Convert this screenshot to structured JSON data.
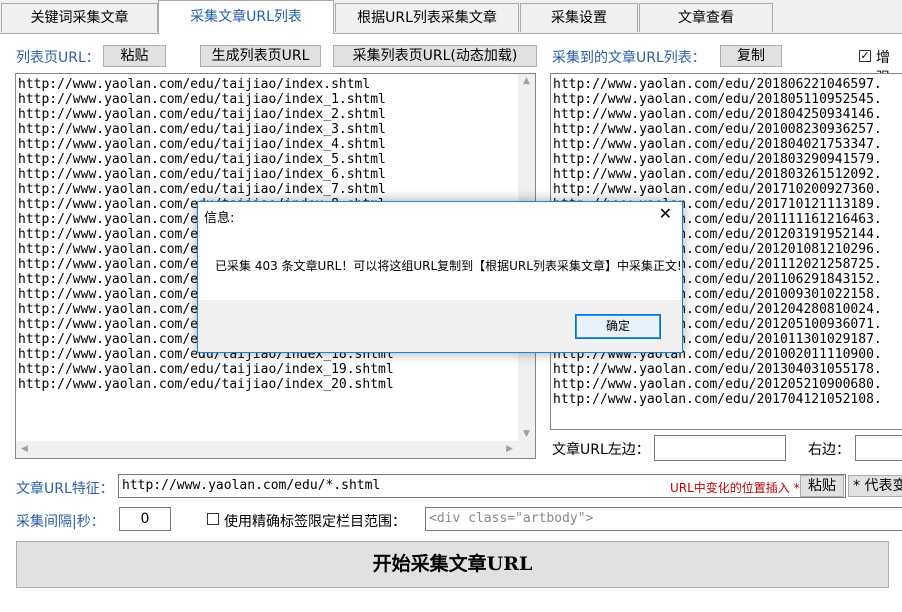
{
  "tabs": [
    {
      "label": "关键词采集文章"
    },
    {
      "label": "采集文章URL列表"
    },
    {
      "label": "根据URL列表采集文章"
    },
    {
      "label": "采集设置"
    },
    {
      "label": "文章查看"
    }
  ],
  "left_panel": {
    "label": "列表页URL：",
    "paste_button": "粘贴",
    "generate_button": "生成列表页URL",
    "collect_button": "采集列表页URL(动态加载)",
    "urls": [
      "http://www.yaolan.com/edu/taijiao/index.shtml",
      "http://www.yaolan.com/edu/taijiao/index_1.shtml",
      "http://www.yaolan.com/edu/taijiao/index_2.shtml",
      "http://www.yaolan.com/edu/taijiao/index_3.shtml",
      "http://www.yaolan.com/edu/taijiao/index_4.shtml",
      "http://www.yaolan.com/edu/taijiao/index_5.shtml",
      "http://www.yaolan.com/edu/taijiao/index_6.shtml",
      "http://www.yaolan.com/edu/taijiao/index_7.shtml",
      "http://www.yaolan.com/edu/taijiao/index_8.shtml",
      "http://www.yaolan.com/edu/taijiao/index_9.shtml",
      "http://www.yaolan.com/edu/taijiao/index_10.shtml",
      "http://www.yaolan.com/edu/taijiao/index_11.shtml",
      "http://www.yaolan.com/edu/taijiao/index_12.shtml",
      "http://www.yaolan.com/edu/taijiao/index_13.shtml",
      "http://www.yaolan.com/edu/taijiao/index_14.shtml",
      "http://www.yaolan.com/edu/taijiao/index_15.shtml",
      "http://www.yaolan.com/edu/taijiao/index_16.shtml",
      "http://www.yaolan.com/edu/taijiao/index_17.shtml",
      "http://www.yaolan.com/edu/taijiao/index_18.shtml",
      "http://www.yaolan.com/edu/taijiao/index_19.shtml",
      "http://www.yaolan.com/edu/taijiao/index_20.shtml"
    ]
  },
  "right_panel": {
    "label": "采集到的文章URL列表：",
    "copy_button": "复制",
    "enhance_checkbox_label": "增强",
    "enhance_checked": true,
    "urls": [
      "http://www.yaolan.com/edu/201806221046597.",
      "http://www.yaolan.com/edu/201805110952545.",
      "http://www.yaolan.com/edu/201804250934146.",
      "http://www.yaolan.com/edu/201008230936257.",
      "http://www.yaolan.com/edu/201804021753347.",
      "http://www.yaolan.com/edu/201803290941579.",
      "http://www.yaolan.com/edu/201803261512092.",
      "http://www.yaolan.com/edu/201710200927360.",
      "http://www.yaolan.com/edu/201710121113189.",
      "http://www.yaolan.com/edu/201111161216463.",
      "http://www.yaolan.com/edu/201203191952144.",
      "http://www.yaolan.com/edu/201201081210296.",
      "http://www.yaolan.com/edu/201112021258725.",
      "http://www.yaolan.com/edu/201106291843152.",
      "http://www.yaolan.com/edu/201009301022158.",
      "http://www.yaolan.com/edu/201204280810024.",
      "http://www.yaolan.com/edu/201205100936071.",
      "http://www.yaolan.com/edu/201011301029187.",
      "http://www.yaolan.com/edu/201002011110900.",
      "http://www.yaolan.com/edu/201304031055178.",
      "http://www.yaolan.com/edu/201205210900680.",
      "http://www.yaolan.com/edu/201704121052108."
    ],
    "left_boundary_label": "文章URL左边：",
    "left_boundary_value": "",
    "right_boundary_label": "右边：",
    "right_boundary_value": ""
  },
  "bottom": {
    "feature_label": "文章URL特征：",
    "feature_value": "http://www.yaolan.com/edu/*.shtml",
    "feature_hint": "URL中变化的位置插入 *",
    "feature_paste_button": "粘贴",
    "star_button": "* 代表变",
    "interval_label": "采集间隔|秒：",
    "interval_value": "0",
    "precise_checkbox_label": "使用精确标签限定栏目范围：",
    "precise_checked": false,
    "precise_value": "<div class=\"artbody\">",
    "start_button": "开始采集文章URL"
  },
  "dialog": {
    "title": "信息:",
    "message": "已采集 403 条文章URL！可以将这组URL复制到【根据URL列表采集文章】中采集正文!",
    "ok_button": "确定"
  },
  "colors": {
    "label_blue": "#2b5fa5",
    "hint_red": "#c00000",
    "dialog_border": "#1883d7"
  }
}
